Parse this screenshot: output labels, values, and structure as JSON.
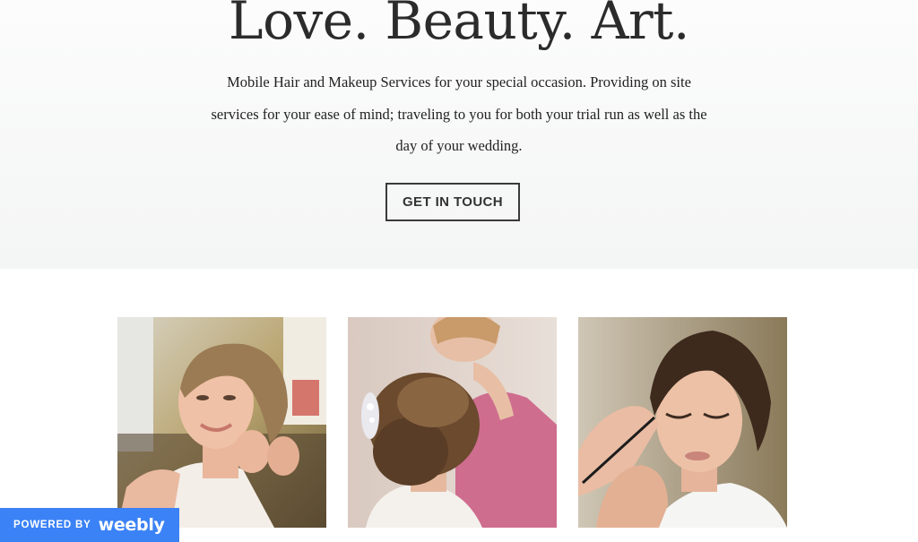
{
  "hero": {
    "title": "Love. Beauty. Art.",
    "description_lines": [
      "Mobile Hair and Makeup Services for your special occasion. Providing on site",
      "services for your ease of mind; traveling to you for both your trial run as well as the",
      "day of your wedding."
    ],
    "cta_label": "GET IN TOUCH"
  },
  "gallery": {
    "images": [
      {
        "subject": "bride-earring-photo"
      },
      {
        "subject": "bridal-updo-photo"
      },
      {
        "subject": "eye-makeup-photo"
      }
    ]
  },
  "badge": {
    "powered_label": "POWERED BY",
    "logo_text": "weebly",
    "color": "#3b82f6"
  },
  "colors": {
    "heading": "#2b2b2b",
    "body_text": "#222222",
    "hero_background": "#f6f7f7"
  }
}
